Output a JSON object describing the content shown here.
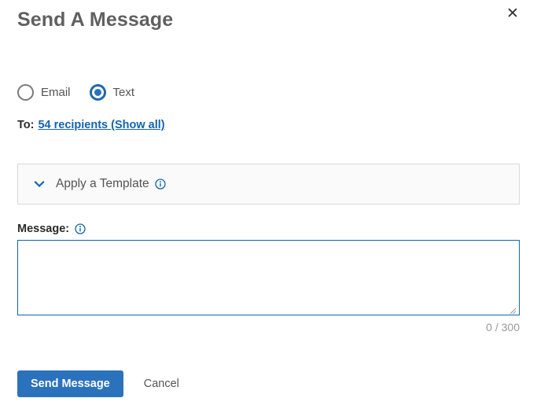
{
  "dialog": {
    "title": "Send A Message",
    "close_icon": "close-icon",
    "close_label": "✕"
  },
  "channel": {
    "options": [
      {
        "label": "Email",
        "value": "email",
        "selected": false
      },
      {
        "label": "Text",
        "value": "text",
        "selected": true
      }
    ]
  },
  "recipients": {
    "label": "To:",
    "link_text": "54 recipients (Show all)",
    "count": 54
  },
  "template": {
    "chevron_icon": "chevron-down-icon",
    "label": "Apply a Template",
    "info_icon": "info-icon",
    "expanded": false
  },
  "message": {
    "label": "Message:",
    "info_icon": "info-icon",
    "value": "",
    "placeholder": "",
    "char_count": 0,
    "char_limit": 300,
    "counter_text": "0 / 300",
    "resize_handle": "resize-grip-icon"
  },
  "footer": {
    "send_label": "Send Message",
    "cancel_label": "Cancel"
  },
  "colors": {
    "accent": "#2b72bd",
    "link": "#1464ad",
    "title_text": "#606060",
    "body_text": "#555555",
    "panel_bg": "#fafafa",
    "panel_border": "#d8d8d8",
    "muted_text": "#9a9a9a"
  }
}
